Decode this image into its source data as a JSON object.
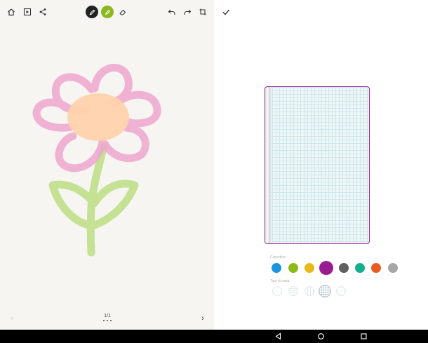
{
  "left_toolbar": {
    "icons": [
      "home-icon",
      "play-icon",
      "share-icon",
      "pen-icon",
      "highlighter-icon",
      "eraser-icon",
      "undo-icon",
      "redo-icon",
      "crop-icon"
    ],
    "accent": "#8ab81f"
  },
  "drawing": {
    "petal_color": "#f0a9cf",
    "center_color": "#ffd3ad",
    "stem_color": "#bfdf8a"
  },
  "pager": {
    "page": "1/1"
  },
  "right_panel": {
    "cover_label": "Copertina",
    "paper_label": "Tipo di carta",
    "selected_color": "#9a1a92",
    "cover_colors": [
      "#1a96e0",
      "#8cba1c",
      "#e8b91a",
      "#9a1a92",
      "#606060",
      "#14b08c",
      "#e85c20",
      "#a6a6a6"
    ],
    "paper_types": [
      "blank",
      "lined",
      "narrow-lined",
      "grid",
      "dotted"
    ]
  },
  "navbar": {
    "icons": [
      "back-icon",
      "home-icon",
      "recents-icon"
    ]
  }
}
